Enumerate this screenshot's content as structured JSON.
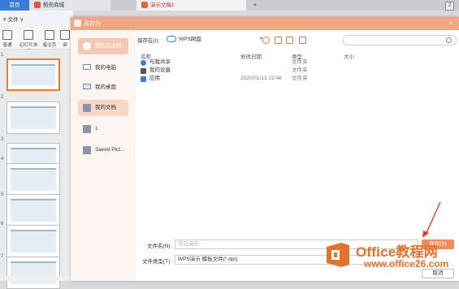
{
  "tabs": {
    "home": "首页",
    "store": "稻壳商城",
    "doc": "演示文稿1",
    "plus": "+",
    "badge": "2"
  },
  "toolbar": {
    "file_menu": "文件"
  },
  "ribbon": {
    "items": [
      "普通",
      "幻灯片浏览",
      "备注页",
      "阅"
    ]
  },
  "slides": {
    "numbers": [
      "1",
      "2",
      "3",
      "4",
      "5",
      "6",
      "7"
    ]
  },
  "dialog": {
    "title": "另存为",
    "close": "×",
    "sidebar": [
      {
        "label": "我的云文档",
        "icon": "cloud-shield-icon"
      },
      {
        "label": "我的电脑",
        "icon": "computer-icon"
      },
      {
        "label": "我的桌面",
        "icon": "desktop-icon"
      },
      {
        "label": "我的文档",
        "icon": "folder-icon"
      },
      {
        "label": "1",
        "icon": "folder-icon"
      },
      {
        "label": "Saved Pict...",
        "icon": "folder-icon"
      }
    ],
    "save_in_label": "保存在(I):",
    "save_in_value": "WPS网盘",
    "columns": {
      "name": "名称",
      "modified": "修改日期",
      "type": "类型",
      "size": "大小"
    },
    "files": [
      {
        "name": "与我共享",
        "modified": "",
        "type": "文件夹",
        "icon": "share-icon"
      },
      {
        "name": "我的设备",
        "modified": "",
        "type": "文件夹",
        "icon": "device-icon"
      },
      {
        "name": "应用",
        "modified": "2020/01/13 22:48",
        "type": "文件夹",
        "icon": "app-icon"
      }
    ],
    "filename_label": "文件名(N):",
    "filename_placeholder": "空白演示",
    "filetype_label": "文件类型(T):",
    "filetype_value": "WPS演示 模板文件(*.dpt)",
    "save_button": "保存(S)",
    "cancel_button": "取消"
  },
  "watermark": {
    "line1": "Office教程网",
    "line2": "www.office26.com"
  },
  "colors": {
    "accent": "#f28b5b",
    "titlebar": "#f2a684",
    "tab_blue": "#3c7bd6",
    "watermark": "#e2732b"
  }
}
